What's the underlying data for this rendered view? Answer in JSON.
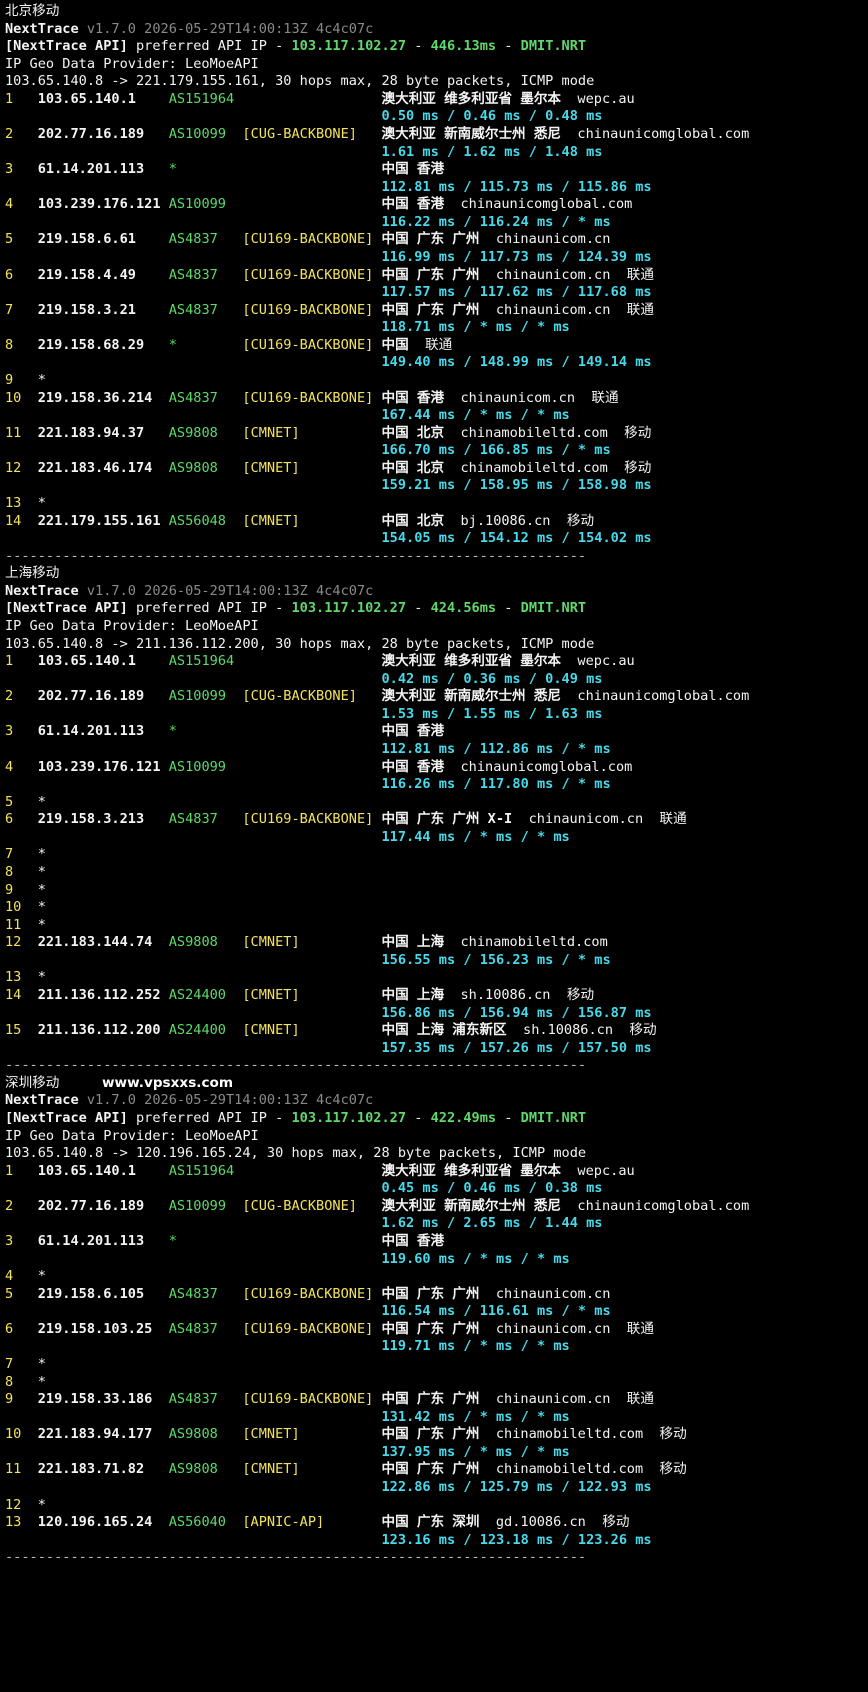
{
  "tool": {
    "name": "NextTrace",
    "version": "v1.7.0 2026-05-29T14:00:13Z 4c4c07c",
    "api_label": "[NextTrace API]",
    "api_text": " preferred API IP - ",
    "api_ip": "103.117.102.27",
    "api_node": "DMIT.NRT",
    "geo_provider": "IP Geo Data Provider: LeoMoeAPI"
  },
  "divider": "-----------------------------------------------------------------------",
  "sections": [
    {
      "title": "北京移动",
      "website": "",
      "api_latency": "446.13ms",
      "summary": "103.65.140.8 -> 221.179.155.161, 30 hops max, 28 byte packets, ICMP mode",
      "hops": [
        {
          "n": "1",
          "ip": "103.65.140.1",
          "asn": "AS151964",
          "tag": "",
          "geo": "澳大利亚 维多利亚省 墨尔本",
          "domain": "wepc.au",
          "isp": "",
          "rtt": "0.50 ms / 0.46 ms / 0.48 ms"
        },
        {
          "n": "2",
          "ip": "202.77.16.189",
          "asn": "AS10099",
          "tag": "[CUG-BACKBONE]",
          "geo": "澳大利亚 新南威尔士州 悉尼",
          "domain": "chinaunicomglobal.com",
          "isp": "",
          "rtt": "1.61 ms / 1.62 ms / 1.48 ms"
        },
        {
          "n": "3",
          "ip": "61.14.201.113",
          "asn": "*",
          "tag": "",
          "geo": "中国 香港",
          "domain": "",
          "isp": "",
          "rtt": "112.81 ms / 115.73 ms / 115.86 ms"
        },
        {
          "n": "4",
          "ip": "103.239.176.121",
          "asn": "AS10099",
          "tag": "",
          "geo": "中国 香港",
          "domain": "chinaunicomglobal.com",
          "isp": "",
          "rtt": "116.22 ms / 116.24 ms / * ms"
        },
        {
          "n": "5",
          "ip": "219.158.6.61",
          "asn": "AS4837",
          "tag": "[CU169-BACKBONE]",
          "geo": "中国 广东 广州",
          "domain": "chinaunicom.cn",
          "isp": "",
          "rtt": "116.99 ms / 117.73 ms / 124.39 ms"
        },
        {
          "n": "6",
          "ip": "219.158.4.49",
          "asn": "AS4837",
          "tag": "[CU169-BACKBONE]",
          "geo": "中国 广东 广州",
          "domain": "chinaunicom.cn",
          "isp": "联通",
          "rtt": "117.57 ms / 117.62 ms / 117.68 ms"
        },
        {
          "n": "7",
          "ip": "219.158.3.21",
          "asn": "AS4837",
          "tag": "[CU169-BACKBONE]",
          "geo": "中国 广东 广州",
          "domain": "chinaunicom.cn",
          "isp": "联通",
          "rtt": "118.71 ms / * ms / * ms"
        },
        {
          "n": "8",
          "ip": "219.158.68.29",
          "asn": "*",
          "tag": "[CU169-BACKBONE]",
          "geo": "中国",
          "domain": "",
          "isp": "联通",
          "rtt": "149.40 ms / 148.99 ms / 149.14 ms"
        },
        {
          "n": "9",
          "ip": "*",
          "asn": "",
          "tag": "",
          "geo": "",
          "domain": "",
          "isp": "",
          "rtt": ""
        },
        {
          "n": "10",
          "ip": "219.158.36.214",
          "asn": "AS4837",
          "tag": "[CU169-BACKBONE]",
          "geo": "中国 香港",
          "domain": "chinaunicom.cn",
          "isp": "联通",
          "rtt": "167.44 ms / * ms / * ms"
        },
        {
          "n": "11",
          "ip": "221.183.94.37",
          "asn": "AS9808",
          "tag": "[CMNET]",
          "geo": "中国 北京",
          "domain": "chinamobileltd.com",
          "isp": "移动",
          "rtt": "166.70 ms / 166.85 ms / * ms"
        },
        {
          "n": "12",
          "ip": "221.183.46.174",
          "asn": "AS9808",
          "tag": "[CMNET]",
          "geo": "中国 北京",
          "domain": "chinamobileltd.com",
          "isp": "移动",
          "rtt": "159.21 ms / 158.95 ms / 158.98 ms"
        },
        {
          "n": "13",
          "ip": "*",
          "asn": "",
          "tag": "",
          "geo": "",
          "domain": "",
          "isp": "",
          "rtt": ""
        },
        {
          "n": "14",
          "ip": "221.179.155.161",
          "asn": "AS56048",
          "tag": "[CMNET]",
          "geo": "中国 北京",
          "domain": "bj.10086.cn",
          "isp": "移动",
          "rtt": "154.05 ms / 154.12 ms / 154.02 ms"
        }
      ]
    },
    {
      "title": "上海移动",
      "website": "",
      "api_latency": "424.56ms",
      "summary": "103.65.140.8 -> 211.136.112.200, 30 hops max, 28 byte packets, ICMP mode",
      "hops": [
        {
          "n": "1",
          "ip": "103.65.140.1",
          "asn": "AS151964",
          "tag": "",
          "geo": "澳大利亚 维多利亚省 墨尔本",
          "domain": "wepc.au",
          "isp": "",
          "rtt": "0.42 ms / 0.36 ms / 0.49 ms"
        },
        {
          "n": "2",
          "ip": "202.77.16.189",
          "asn": "AS10099",
          "tag": "[CUG-BACKBONE]",
          "geo": "澳大利亚 新南威尔士州 悉尼",
          "domain": "chinaunicomglobal.com",
          "isp": "",
          "rtt": "1.53 ms / 1.55 ms / 1.63 ms"
        },
        {
          "n": "3",
          "ip": "61.14.201.113",
          "asn": "*",
          "tag": "",
          "geo": "中国 香港",
          "domain": "",
          "isp": "",
          "rtt": "112.81 ms / 112.86 ms / * ms"
        },
        {
          "n": "4",
          "ip": "103.239.176.121",
          "asn": "AS10099",
          "tag": "",
          "geo": "中国 香港",
          "domain": "chinaunicomglobal.com",
          "isp": "",
          "rtt": "116.26 ms / 117.80 ms / * ms"
        },
        {
          "n": "5",
          "ip": "*",
          "asn": "",
          "tag": "",
          "geo": "",
          "domain": "",
          "isp": "",
          "rtt": ""
        },
        {
          "n": "6",
          "ip": "219.158.3.213",
          "asn": "AS4837",
          "tag": "[CU169-BACKBONE]",
          "geo": "中国 广东 广州 X-I",
          "domain": "chinaunicom.cn",
          "isp": "联通",
          "rtt": "117.44 ms / * ms / * ms"
        },
        {
          "n": "7",
          "ip": "*",
          "asn": "",
          "tag": "",
          "geo": "",
          "domain": "",
          "isp": "",
          "rtt": ""
        },
        {
          "n": "8",
          "ip": "*",
          "asn": "",
          "tag": "",
          "geo": "",
          "domain": "",
          "isp": "",
          "rtt": ""
        },
        {
          "n": "9",
          "ip": "*",
          "asn": "",
          "tag": "",
          "geo": "",
          "domain": "",
          "isp": "",
          "rtt": ""
        },
        {
          "n": "10",
          "ip": "*",
          "asn": "",
          "tag": "",
          "geo": "",
          "domain": "",
          "isp": "",
          "rtt": ""
        },
        {
          "n": "11",
          "ip": "*",
          "asn": "",
          "tag": "",
          "geo": "",
          "domain": "",
          "isp": "",
          "rtt": ""
        },
        {
          "n": "12",
          "ip": "221.183.144.74",
          "asn": "AS9808",
          "tag": "[CMNET]",
          "geo": "中国 上海",
          "domain": "chinamobileltd.com",
          "isp": "",
          "rtt": "156.55 ms / 156.23 ms / * ms"
        },
        {
          "n": "13",
          "ip": "*",
          "asn": "",
          "tag": "",
          "geo": "",
          "domain": "",
          "isp": "",
          "rtt": ""
        },
        {
          "n": "14",
          "ip": "211.136.112.252",
          "asn": "AS24400",
          "tag": "[CMNET]",
          "geo": "中国 上海",
          "domain": "sh.10086.cn",
          "isp": "移动",
          "rtt": "156.86 ms / 156.94 ms / 156.87 ms"
        },
        {
          "n": "15",
          "ip": "211.136.112.200",
          "asn": "AS24400",
          "tag": "[CMNET]",
          "geo": "中国 上海 浦东新区",
          "domain": "sh.10086.cn",
          "isp": "移动",
          "rtt": "157.35 ms / 157.26 ms / 157.50 ms"
        }
      ]
    },
    {
      "title": "深圳移动",
      "website": "www.vpsxxs.com",
      "api_latency": "422.49ms",
      "summary": "103.65.140.8 -> 120.196.165.24, 30 hops max, 28 byte packets, ICMP mode",
      "hops": [
        {
          "n": "1",
          "ip": "103.65.140.1",
          "asn": "AS151964",
          "tag": "",
          "geo": "澳大利亚 维多利亚省 墨尔本",
          "domain": "wepc.au",
          "isp": "",
          "rtt": "0.45 ms / 0.46 ms / 0.38 ms"
        },
        {
          "n": "2",
          "ip": "202.77.16.189",
          "asn": "AS10099",
          "tag": "[CUG-BACKBONE]",
          "geo": "澳大利亚 新南威尔士州 悉尼",
          "domain": "chinaunicomglobal.com",
          "isp": "",
          "rtt": "1.62 ms / 2.65 ms / 1.44 ms"
        },
        {
          "n": "3",
          "ip": "61.14.201.113",
          "asn": "*",
          "tag": "",
          "geo": "中国 香港",
          "domain": "",
          "isp": "",
          "rtt": "119.60 ms / * ms / * ms"
        },
        {
          "n": "4",
          "ip": "*",
          "asn": "",
          "tag": "",
          "geo": "",
          "domain": "",
          "isp": "",
          "rtt": ""
        },
        {
          "n": "5",
          "ip": "219.158.6.105",
          "asn": "AS4837",
          "tag": "[CU169-BACKBONE]",
          "geo": "中国 广东 广州",
          "domain": "chinaunicom.cn",
          "isp": "",
          "rtt": "116.54 ms / 116.61 ms / * ms"
        },
        {
          "n": "6",
          "ip": "219.158.103.25",
          "asn": "AS4837",
          "tag": "[CU169-BACKBONE]",
          "geo": "中国 广东 广州",
          "domain": "chinaunicom.cn",
          "isp": "联通",
          "rtt": "119.71 ms / * ms / * ms"
        },
        {
          "n": "7",
          "ip": "*",
          "asn": "",
          "tag": "",
          "geo": "",
          "domain": "",
          "isp": "",
          "rtt": ""
        },
        {
          "n": "8",
          "ip": "*",
          "asn": "",
          "tag": "",
          "geo": "",
          "domain": "",
          "isp": "",
          "rtt": ""
        },
        {
          "n": "9",
          "ip": "219.158.33.186",
          "asn": "AS4837",
          "tag": "[CU169-BACKBONE]",
          "geo": "中国 广东 广州",
          "domain": "chinaunicom.cn",
          "isp": "联通",
          "rtt": "131.42 ms / * ms / * ms"
        },
        {
          "n": "10",
          "ip": "221.183.94.177",
          "asn": "AS9808",
          "tag": "[CMNET]",
          "geo": "中国 广东 广州",
          "domain": "chinamobileltd.com",
          "isp": "移动",
          "rtt": "137.95 ms / * ms / * ms"
        },
        {
          "n": "11",
          "ip": "221.183.71.82",
          "asn": "AS9808",
          "tag": "[CMNET]",
          "geo": "中国 广东 广州",
          "domain": "chinamobileltd.com",
          "isp": "移动",
          "rtt": "122.86 ms / 125.79 ms / 122.93 ms"
        },
        {
          "n": "12",
          "ip": "*",
          "asn": "",
          "tag": "",
          "geo": "",
          "domain": "",
          "isp": "",
          "rtt": ""
        },
        {
          "n": "13",
          "ip": "120.196.165.24",
          "asn": "AS56040",
          "tag": "[APNIC-AP]",
          "geo": "中国 广东 深圳",
          "domain": "gd.10086.cn",
          "isp": "移动",
          "rtt": "123.16 ms / 123.18 ms / 123.26 ms"
        }
      ]
    }
  ]
}
